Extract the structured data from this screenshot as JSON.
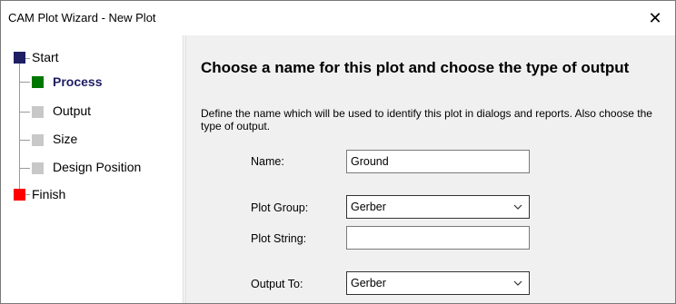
{
  "window": {
    "title": "CAM Plot  Wizard - New Plot",
    "close_glyph": "✕"
  },
  "steps": [
    {
      "label": "Start",
      "color": "#1e1e64",
      "active": false
    },
    {
      "label": "Process",
      "color": "#007800",
      "active": true
    },
    {
      "label": "Output",
      "color": "#c8c8c8",
      "active": false
    },
    {
      "label": "Size",
      "color": "#c8c8c8",
      "active": false
    },
    {
      "label": "Design Position",
      "color": "#c8c8c8",
      "active": false
    },
    {
      "label": "Finish",
      "color": "#ff0000",
      "active": false
    }
  ],
  "page": {
    "heading": "Choose a name for this plot and choose the type of output",
    "description": "Define the name which will be used to identify this plot in dialogs and reports. Also choose the type of output."
  },
  "form": {
    "name_label": "Name:",
    "name_value": "Ground",
    "plot_group_label": "Plot Group:",
    "plot_group_value": "Gerber",
    "plot_string_label": "Plot String:",
    "plot_string_value": "",
    "output_to_label": "Output To:",
    "output_to_value": "Gerber"
  },
  "icons": {
    "close": "close-icon",
    "dropdown": "chevron-down-icon"
  }
}
